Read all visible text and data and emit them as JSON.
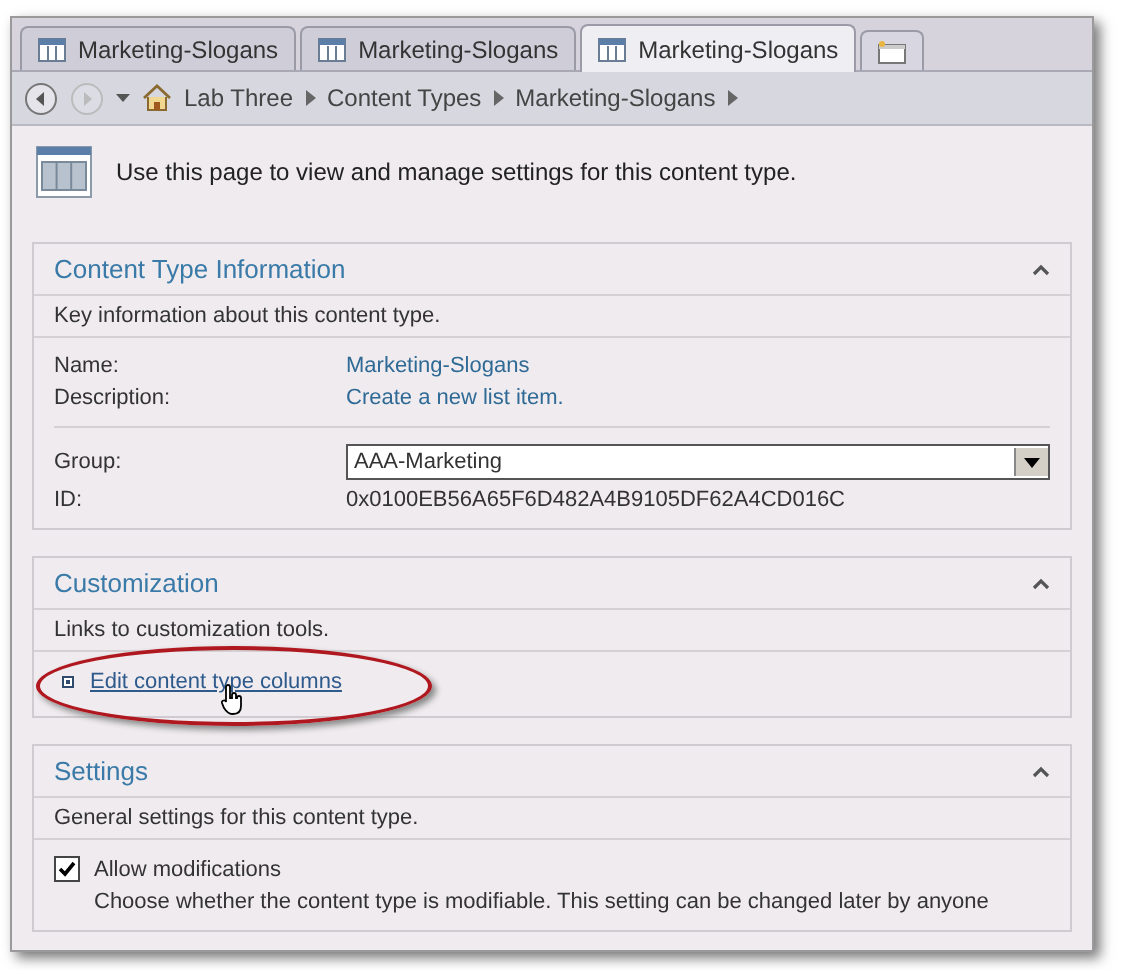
{
  "tabs": [
    {
      "label": "Marketing-Slogans",
      "selected": false
    },
    {
      "label": "Marketing-Slogans",
      "selected": false
    },
    {
      "label": "Marketing-Slogans",
      "selected": true
    }
  ],
  "breadcrumb": [
    "Lab Three",
    "Content Types",
    "Marketing-Slogans"
  ],
  "intro": "Use this page to view and manage settings for this content type.",
  "sections": [
    {
      "kind": "info",
      "title": "Content Type Information",
      "expanded": true,
      "description": "Key information about this content type.",
      "field_groups": [
        [
          {
            "label": "Name:",
            "value": "Marketing-Slogans",
            "kind": "link"
          },
          {
            "label": "Description:",
            "value": "Create a new list item.",
            "kind": "link"
          }
        ],
        [
          {
            "label": "Group:",
            "value": "AAA-Marketing",
            "kind": "dropdown"
          },
          {
            "label": "ID:",
            "value": "0x0100EB56A65F6D482A4B9105DF62A4CD016C",
            "kind": "text"
          }
        ]
      ]
    },
    {
      "kind": "links",
      "title": "Customization",
      "expanded": true,
      "description": "Links to customization tools.",
      "links": [
        {
          "label": "Edit content type columns",
          "highlighted": true
        }
      ]
    },
    {
      "kind": "options",
      "title": "Settings",
      "expanded": true,
      "description": "General settings for this content type.",
      "options": [
        {
          "label": "Allow modifications",
          "checked": true,
          "note": "Choose whether the content type is modifiable.  This setting can be changed later by anyone"
        }
      ]
    }
  ]
}
